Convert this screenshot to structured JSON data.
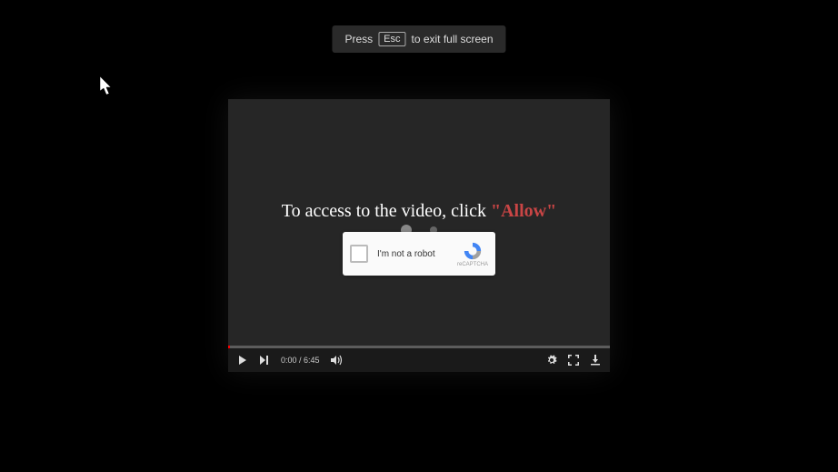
{
  "banner": {
    "press": "Press",
    "key": "Esc",
    "rest": "to exit full screen"
  },
  "overlay": {
    "prefix": "To access to the video, click ",
    "allow": "\"Allow\""
  },
  "captcha": {
    "label": "I'm not a robot",
    "brand": "reCAPTCHA"
  },
  "player": {
    "current_time": "0:00",
    "duration": "6:45",
    "time_display": "0:00 / 6:45"
  }
}
